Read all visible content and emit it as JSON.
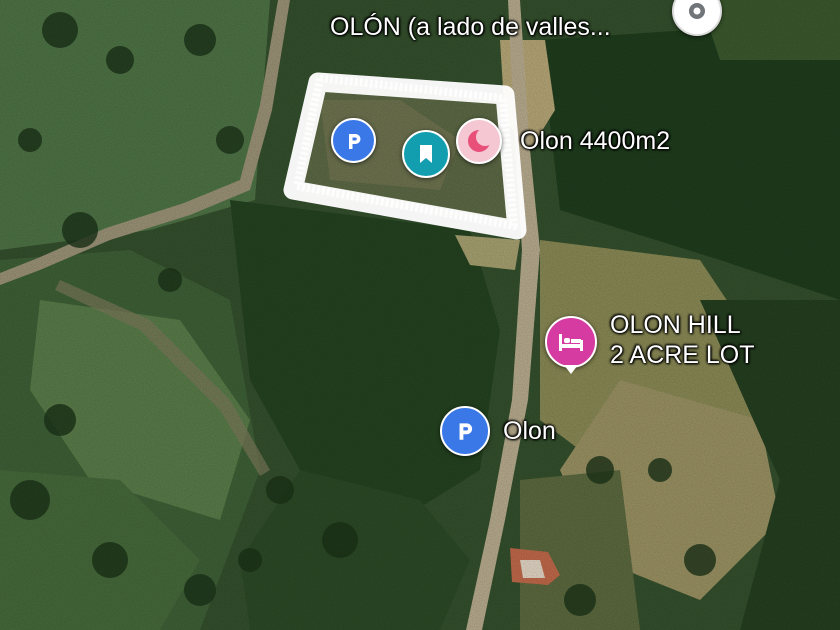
{
  "map": {
    "colors": {
      "parking": "#3b78e7",
      "saved": "#129eaf",
      "wishlist": "#e8507a",
      "hotel": "#d53ba0",
      "boundary": "#ffffff"
    },
    "places": [
      {
        "name": "OLÓN (a lado de valles...",
        "icon": "location-pin-icon"
      },
      {
        "name": "Olon 4400m2",
        "icon": "heart-crescent-icon"
      },
      {
        "name": "OLON HILL",
        "name_line2": "2 ACRE LOT",
        "icon": "hotel-bed-icon"
      },
      {
        "name": "Olon",
        "icon": "parking-icon"
      }
    ],
    "lot_markers": [
      {
        "icon": "parking-icon"
      },
      {
        "icon": "bookmark-icon"
      },
      {
        "icon": "heart-crescent-icon"
      }
    ]
  }
}
